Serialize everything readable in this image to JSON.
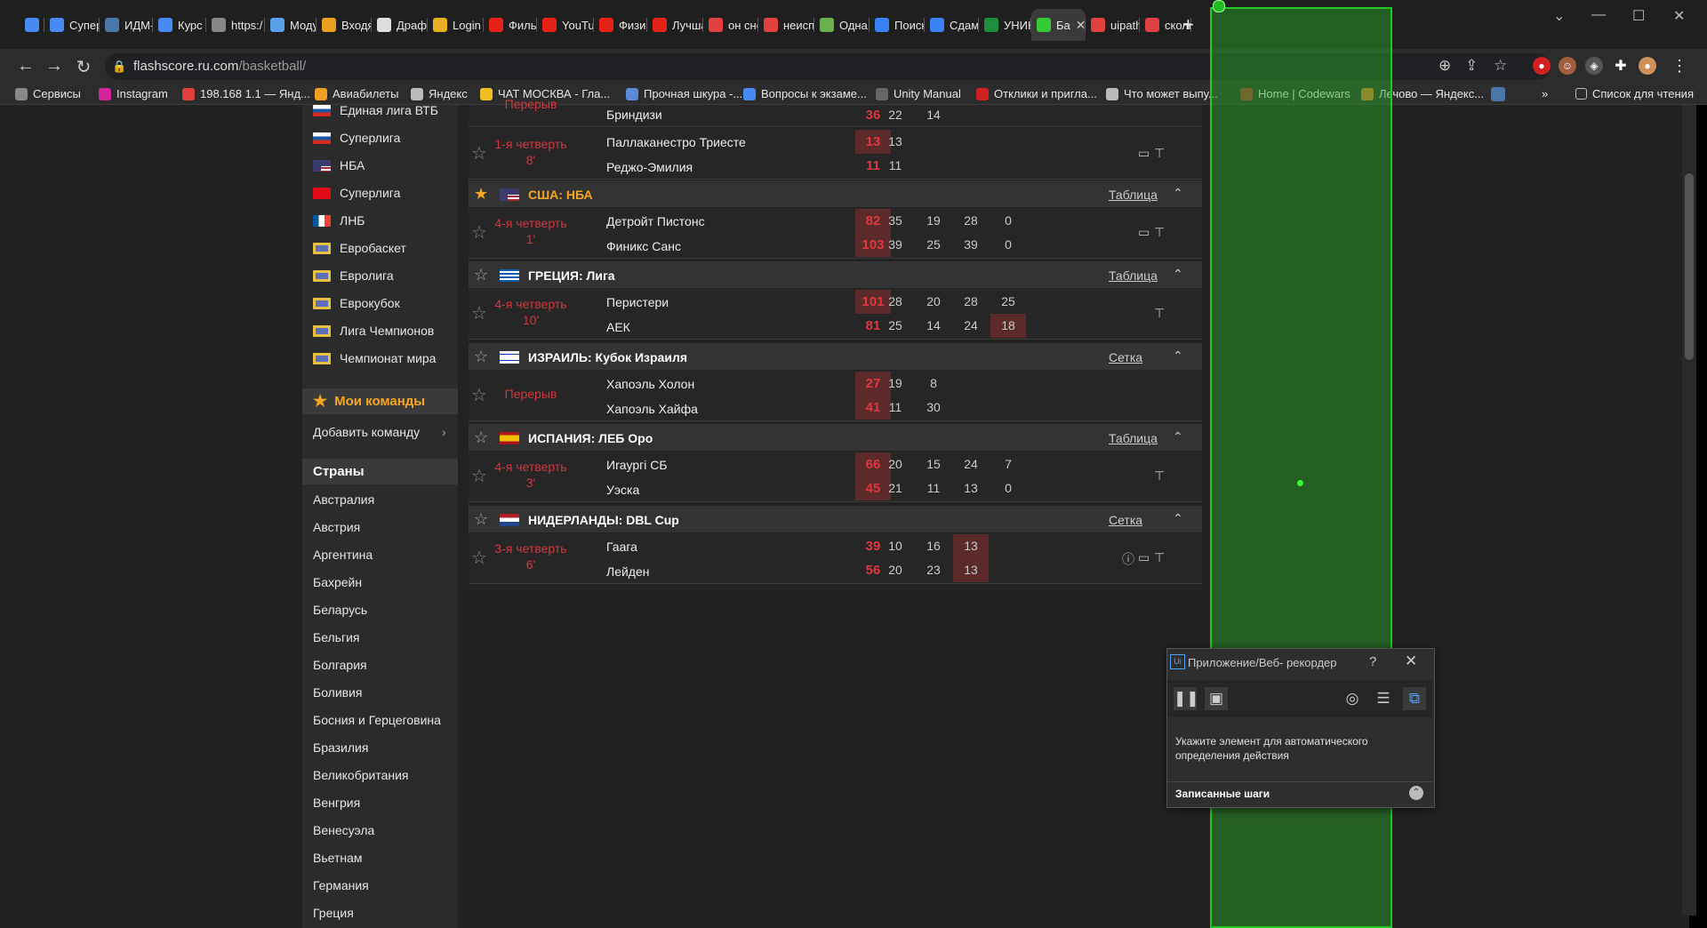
{
  "browser": {
    "tabs": [
      {
        "label": "",
        "icon": "chat-icon",
        "color": "#4a8af4"
      },
      {
        "label": "Супер",
        "icon": "t-icon",
        "color": "#4a8af4"
      },
      {
        "label": "ИДМ-",
        "icon": "vk-icon",
        "color": "#4a76a8"
      },
      {
        "label": "Курс",
        "icon": "t-icon",
        "color": "#4a8af4"
      },
      {
        "label": "https:/",
        "icon": "link-icon",
        "color": "#888888"
      },
      {
        "label": "Моду",
        "icon": "globe-icon",
        "color": "#5aa0e8"
      },
      {
        "label": "Входя",
        "icon": "mail-icon",
        "color": "#e8a020"
      },
      {
        "label": "Драфт",
        "icon": "doc-icon",
        "color": "#dddddd"
      },
      {
        "label": "Login",
        "icon": "login-icon",
        "color": "#e8b020"
      },
      {
        "label": "Фильм",
        "icon": "youtube-icon",
        "color": "#e62117"
      },
      {
        "label": "YouTu",
        "icon": "youtube-icon",
        "color": "#e62117"
      },
      {
        "label": "Физич",
        "icon": "youtube-icon",
        "color": "#e62117"
      },
      {
        "label": "Лучша",
        "icon": "youtube-icon",
        "color": "#e62117"
      },
      {
        "label": "он сно",
        "icon": "yandex-icon",
        "color": "#e04040"
      },
      {
        "label": "неисп",
        "icon": "yandex-icon",
        "color": "#e04040"
      },
      {
        "label": "Одна",
        "icon": "hd-icon",
        "color": "#6ab04c"
      },
      {
        "label": "Поиск",
        "icon": "m-icon",
        "color": "#3b82f6"
      },
      {
        "label": "Сдам",
        "icon": "m-icon",
        "color": "#3b82f6"
      },
      {
        "label": "УНИК",
        "icon": "table-icon",
        "color": "#1e8e3e"
      },
      {
        "label": "Ба",
        "icon": "refresh-icon",
        "color": "#33cc33",
        "active": true
      },
      {
        "label": "uipath",
        "icon": "yandex-icon",
        "color": "#e04040"
      },
      {
        "label": "сколь",
        "icon": "yandex-icon",
        "color": "#e04040"
      }
    ],
    "new_tab": "+",
    "url_host": "flashscore.ru.com",
    "url_path": "/basketball/",
    "bookmarks": [
      {
        "label": "Сервисы",
        "color": "#888888"
      },
      {
        "label": "Instagram",
        "color": "#d6249f"
      },
      {
        "label": "198.168 1.1 — Янд...",
        "color": "#e04040"
      },
      {
        "label": "Авиабилеты",
        "color": "#f0a020"
      },
      {
        "label": "Яндекс",
        "color": "#bbbbbb"
      },
      {
        "label": "ЧАТ МОСКВА - Гла...",
        "color": "#f0c020"
      },
      {
        "label": "Прочная шкура -...",
        "color": "#5a8ad8"
      },
      {
        "label": "Вопросы к экзаме...",
        "color": "#4a8af4"
      },
      {
        "label": "Unity Manual",
        "color": "#666666"
      },
      {
        "label": "Отклики и пригла...",
        "color": "#d02020"
      },
      {
        "label": "Что может выпу...",
        "color": "#bbbbbb"
      },
      {
        "label": "Home | Codewars",
        "color": "#b03030"
      },
      {
        "label": "Лечово — Яндекс...",
        "color": "#e07030"
      }
    ],
    "bookmarks_overflow": "»",
    "reading_list": "Список для чтения"
  },
  "sidebar": {
    "leagues": [
      {
        "label": "Единая лига ВТБ",
        "flag": "ru"
      },
      {
        "label": "Суперлига",
        "flag": "ru"
      },
      {
        "label": "НБА",
        "flag": "us"
      },
      {
        "label": "Суперлига",
        "flag": "tr"
      },
      {
        "label": "ЛНБ",
        "flag": "fr"
      },
      {
        "label": "Евробаскет",
        "flag": "world"
      },
      {
        "label": "Евролига",
        "flag": "world"
      },
      {
        "label": "Еврокубок",
        "flag": "world"
      },
      {
        "label": "Лига Чемпионов",
        "flag": "world"
      },
      {
        "label": "Чемпионат мира",
        "flag": "world"
      }
    ],
    "my_teams": "Мои команды",
    "add_team": "Добавить команду",
    "countries_header": "Страны",
    "countries": [
      "Австралия",
      "Австрия",
      "Аргентина",
      "Бахрейн",
      "Беларусь",
      "Бельгия",
      "Болгария",
      "Боливия",
      "Босния и Герцеговина",
      "Бразилия",
      "Великобритания",
      "Венгрия",
      "Венесуэла",
      "Вьетнам",
      "Германия",
      "Греция"
    ]
  },
  "matches_top": {
    "status": "Перерыв",
    "team": "Бриндизи",
    "score": "36",
    "q": [
      "22",
      "14"
    ]
  },
  "match_italy_2": {
    "status_1": "1-я четверть",
    "status_2": "8'",
    "home": "Паллаканестро Триесте",
    "away": "Реджо-Эмилия",
    "home_score": "13",
    "away_score": "11",
    "home_q": [
      "13"
    ],
    "away_q": [
      "11"
    ]
  },
  "leagues": [
    {
      "name": "США: НБА",
      "link": "Таблица",
      "favorite": true,
      "match": {
        "status_1": "4-я четверть",
        "status_2": "1'",
        "home": "Детройт Пистонс",
        "away": "Финикс Санс",
        "home_score": "82",
        "away_score": "103",
        "home_q": [
          "35",
          "19",
          "28",
          "0"
        ],
        "away_q": [
          "39",
          "25",
          "39",
          "0"
        ]
      }
    },
    {
      "name": "ГРЕЦИЯ: Лига",
      "link": "Таблица",
      "match": {
        "status_1": "4-я четверть",
        "status_2": "10'",
        "home": "Перистери",
        "away": "АЕК",
        "home_score": "101",
        "away_score": "81",
        "home_q": [
          "28",
          "20",
          "28",
          "25"
        ],
        "away_q": [
          "25",
          "14",
          "24",
          "18"
        ]
      }
    },
    {
      "name": "ИЗРАИЛЬ: Кубок Израиля",
      "link": "Сетка",
      "match": {
        "status_1": "Перерыв",
        "status_2": "",
        "home": "Хапоэль Холон",
        "away": "Хапоэль Хайфа",
        "home_score": "27",
        "away_score": "41",
        "home_q": [
          "19",
          "8"
        ],
        "away_q": [
          "11",
          "30"
        ]
      }
    },
    {
      "name": "ИСПАНИЯ: ЛЕБ Оро",
      "link": "Таблица",
      "match": {
        "status_1": "4-я четверть",
        "status_2": "3'",
        "home": "Иraургi СБ",
        "away": "Уэска",
        "home_score": "66",
        "away_score": "45",
        "home_q": [
          "20",
          "15",
          "24",
          "7"
        ],
        "away_q": [
          "21",
          "11",
          "13",
          "0"
        ]
      }
    },
    {
      "name": "НИДЕРЛАНДЫ: DBL Cup",
      "link": "Сетка",
      "match": {
        "status_1": "3-я четверть",
        "status_2": "6'",
        "home": "Гаага",
        "away": "Лейден",
        "home_score": "39",
        "away_score": "56",
        "home_q": [
          "10",
          "16",
          "13"
        ],
        "away_q": [
          "20",
          "23",
          "13"
        ]
      }
    }
  ],
  "recorder": {
    "title": "Приложение/Веб- рекордер",
    "help": "?",
    "close": "✕",
    "message": "Укажите элемент для автоматического определения действия",
    "steps_label": "Записанные шаги"
  },
  "colors": {
    "accent_orange": "#f5a623",
    "live_red": "#e0383e",
    "overlay_green": "#23c923"
  }
}
